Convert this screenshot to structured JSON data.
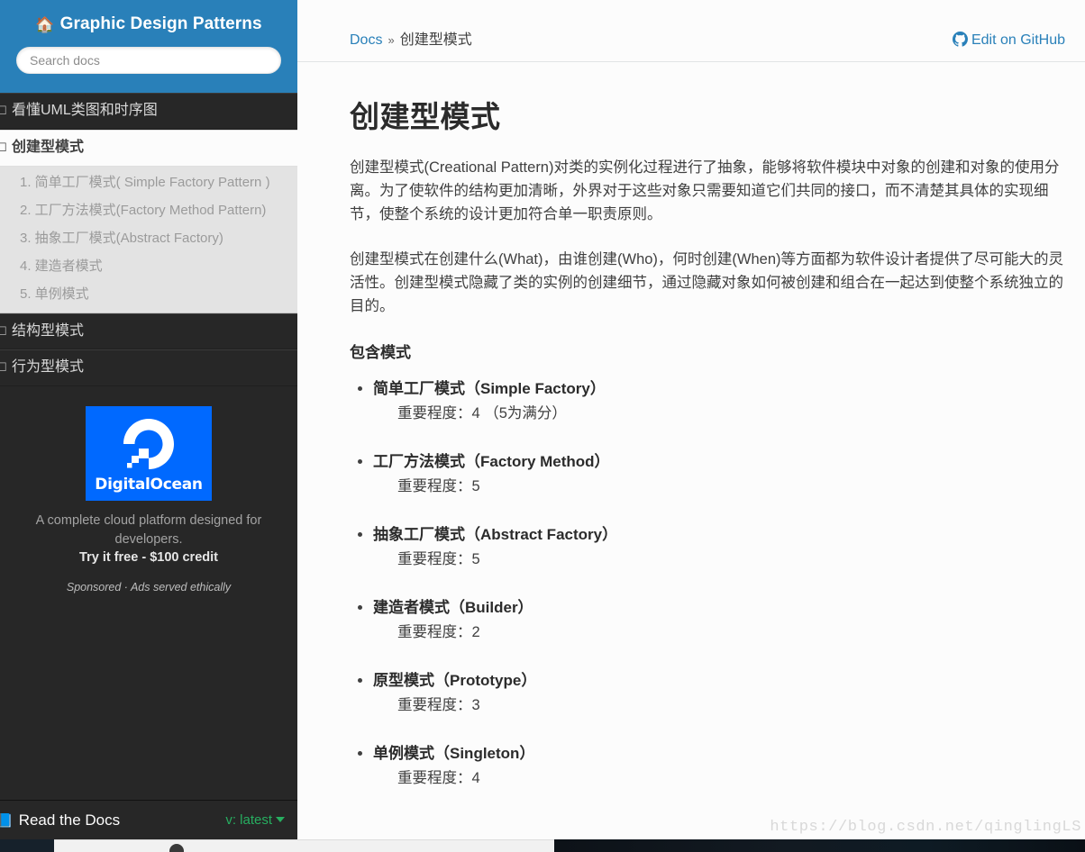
{
  "sidebar": {
    "brand": "Graphic Design Patterns",
    "brand_icon": "home-icon",
    "search": {
      "placeholder": "Search docs",
      "value": ""
    },
    "nav": [
      {
        "label": "看懂UML类图和时序图",
        "current": false
      },
      {
        "label": "创建型模式",
        "current": true
      },
      {
        "label": "结构型模式",
        "current": false
      },
      {
        "label": "行为型模式",
        "current": false
      }
    ],
    "sub_nav": [
      "1. 简单工厂模式( Simple Factory Pattern )",
      "2. 工厂方法模式(Factory Method Pattern)",
      "3. 抽象工厂模式(Abstract Factory)",
      "4. 建造者模式",
      "5. 单例模式"
    ],
    "ad": {
      "logo_text": "DigitalOcean",
      "logo_bg": "#0069ff",
      "description": "A complete cloud platform designed for developers.",
      "cta": "Try it free - $100 credit",
      "disclosure": "Sponsored · Ads served ethically"
    },
    "footer": {
      "label": "Read the Docs",
      "icon": "book-icon",
      "version": "v: latest"
    }
  },
  "header": {
    "breadcrumb_root": "Docs",
    "breadcrumb_sep": "»",
    "breadcrumb_current": "创建型模式",
    "edit_link": "Edit on GitHub",
    "edit_icon": "github-icon",
    "accent_color": "#2980b9"
  },
  "content": {
    "title": "创建型模式",
    "paragraphs": [
      "创建型模式(Creational Pattern)对类的实例化过程进行了抽象，能够将软件模块中对象的创建和对象的使用分离。为了使软件的结构更加清晰，外界对于这些对象只需要知道它们共同的接口，而不清楚其具体的实现细节，使整个系统的设计更加符合单一职责原则。",
      "创建型模式在创建什么(What)，由谁创建(Who)，何时创建(When)等方面都为软件设计者提供了尽可能大的灵活性。创建型模式隐藏了类的实例的创建细节，通过隐藏对象如何被创建和组合在一起达到使整个系统独立的目的。"
    ],
    "section_heading": "包含模式",
    "patterns": [
      {
        "cn": "简单工厂模式",
        "en": "（Simple Factory）",
        "rating": "重要程度：4 （5为满分）"
      },
      {
        "cn": "工厂方法模式",
        "en": "（Factory Method）",
        "rating": "重要程度：5"
      },
      {
        "cn": "抽象工厂模式",
        "en": "（Abstract Factory）",
        "rating": "重要程度：5"
      },
      {
        "cn": "建造者模式",
        "en": "（Builder）",
        "rating": "重要程度：2"
      },
      {
        "cn": "原型模式",
        "en": "（Prototype）",
        "rating": "重要程度：3"
      },
      {
        "cn": "单例模式",
        "en": "（Singleton）",
        "rating": "重要程度：4"
      }
    ]
  },
  "watermark": "https://blog.csdn.net/qinglingLS"
}
